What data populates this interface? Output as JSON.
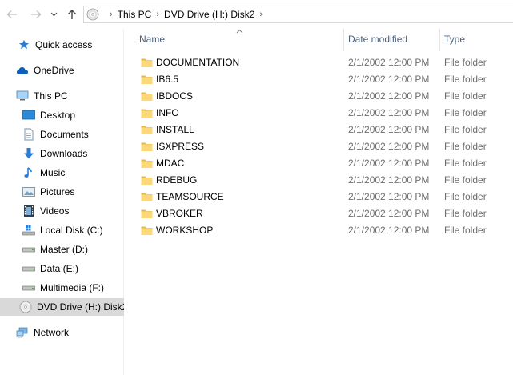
{
  "address": {
    "crumbs": [
      "This PC",
      "DVD Drive (H:) Disk2"
    ]
  },
  "nav": {
    "quick_access": "Quick access",
    "onedrive": "OneDrive",
    "this_pc": "This PC",
    "desktop": "Desktop",
    "documents": "Documents",
    "downloads": "Downloads",
    "music": "Music",
    "pictures": "Pictures",
    "videos": "Videos",
    "local_disk": "Local Disk (C:)",
    "master": "Master (D:)",
    "data": "Data (E:)",
    "multimedia": "Multimedia (F:)",
    "dvd": "DVD Drive (H:) Disk2",
    "network": "Network"
  },
  "columns": {
    "name": "Name",
    "date": "Date modified",
    "type": "Type"
  },
  "files": [
    {
      "name": "DOCUMENTATION",
      "date": "2/1/2002 12:00 PM",
      "type": "File folder"
    },
    {
      "name": "IB6.5",
      "date": "2/1/2002 12:00 PM",
      "type": "File folder"
    },
    {
      "name": "IBDOCS",
      "date": "2/1/2002 12:00 PM",
      "type": "File folder"
    },
    {
      "name": "INFO",
      "date": "2/1/2002 12:00 PM",
      "type": "File folder"
    },
    {
      "name": "INSTALL",
      "date": "2/1/2002 12:00 PM",
      "type": "File folder"
    },
    {
      "name": "ISXPRESS",
      "date": "2/1/2002 12:00 PM",
      "type": "File folder"
    },
    {
      "name": "MDAC",
      "date": "2/1/2002 12:00 PM",
      "type": "File folder"
    },
    {
      "name": "RDEBUG",
      "date": "2/1/2002 12:00 PM",
      "type": "File folder"
    },
    {
      "name": "TEAMSOURCE",
      "date": "2/1/2002 12:00 PM",
      "type": "File folder"
    },
    {
      "name": "VBROKER",
      "date": "2/1/2002 12:00 PM",
      "type": "File folder"
    },
    {
      "name": "WORKSHOP",
      "date": "2/1/2002 12:00 PM",
      "type": "File folder"
    }
  ]
}
